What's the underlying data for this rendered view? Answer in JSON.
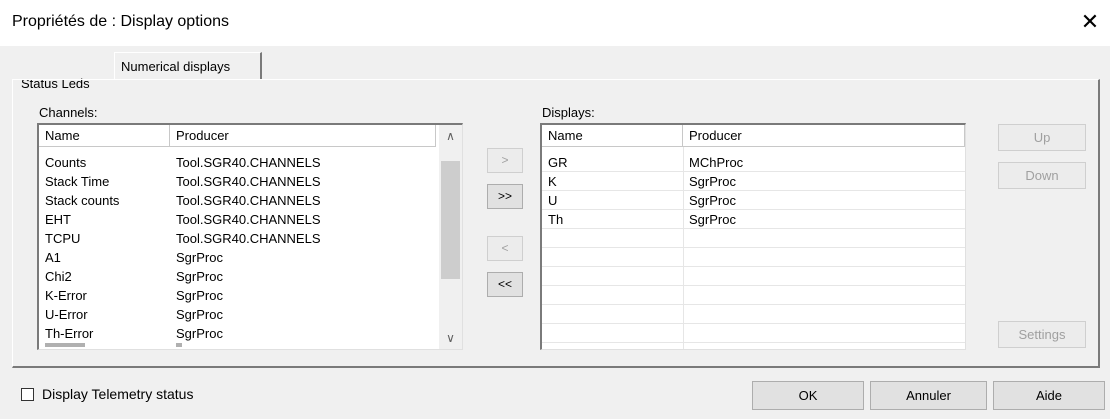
{
  "window": {
    "title": "Propriétés de : Display options",
    "close_glyph": "✕"
  },
  "tabs": [
    {
      "label": "Status Leds",
      "selected": false
    },
    {
      "label": "Numerical displays",
      "selected": true
    }
  ],
  "channels": {
    "label": "Channels:",
    "columns": [
      "Name",
      "Producer"
    ],
    "rows": [
      {
        "name": "Counts",
        "producer": "Tool.SGR40.CHANNELS"
      },
      {
        "name": "Stack Time",
        "producer": "Tool.SGR40.CHANNELS"
      },
      {
        "name": "Stack counts",
        "producer": "Tool.SGR40.CHANNELS"
      },
      {
        "name": "EHT",
        "producer": "Tool.SGR40.CHANNELS"
      },
      {
        "name": "TCPU",
        "producer": "Tool.SGR40.CHANNELS"
      },
      {
        "name": "A1",
        "producer": "SgrProc"
      },
      {
        "name": "Chi2",
        "producer": "SgrProc"
      },
      {
        "name": "K-Error",
        "producer": "SgrProc"
      },
      {
        "name": "U-Error",
        "producer": "SgrProc"
      },
      {
        "name": "Th-Error",
        "producer": "SgrProc"
      }
    ],
    "scroll_up_glyph": "∧",
    "scroll_down_glyph": "∨"
  },
  "transfer_buttons": {
    "add": ">",
    "add_all": ">>",
    "remove": "<",
    "remove_all": "<<"
  },
  "displays": {
    "label": "Displays:",
    "columns": [
      "Name",
      "Producer"
    ],
    "rows": [
      {
        "name": "GR",
        "producer": "MChProc"
      },
      {
        "name": "K",
        "producer": "SgrProc"
      },
      {
        "name": "U",
        "producer": "SgrProc"
      },
      {
        "name": "Th",
        "producer": "SgrProc"
      }
    ]
  },
  "side_buttons": {
    "up": "Up",
    "down": "Down",
    "settings": "Settings"
  },
  "footer": {
    "checkbox_label": "Display Telemetry status",
    "checkbox_checked": false,
    "ok": "OK",
    "cancel": "Annuler",
    "help": "Aide"
  }
}
